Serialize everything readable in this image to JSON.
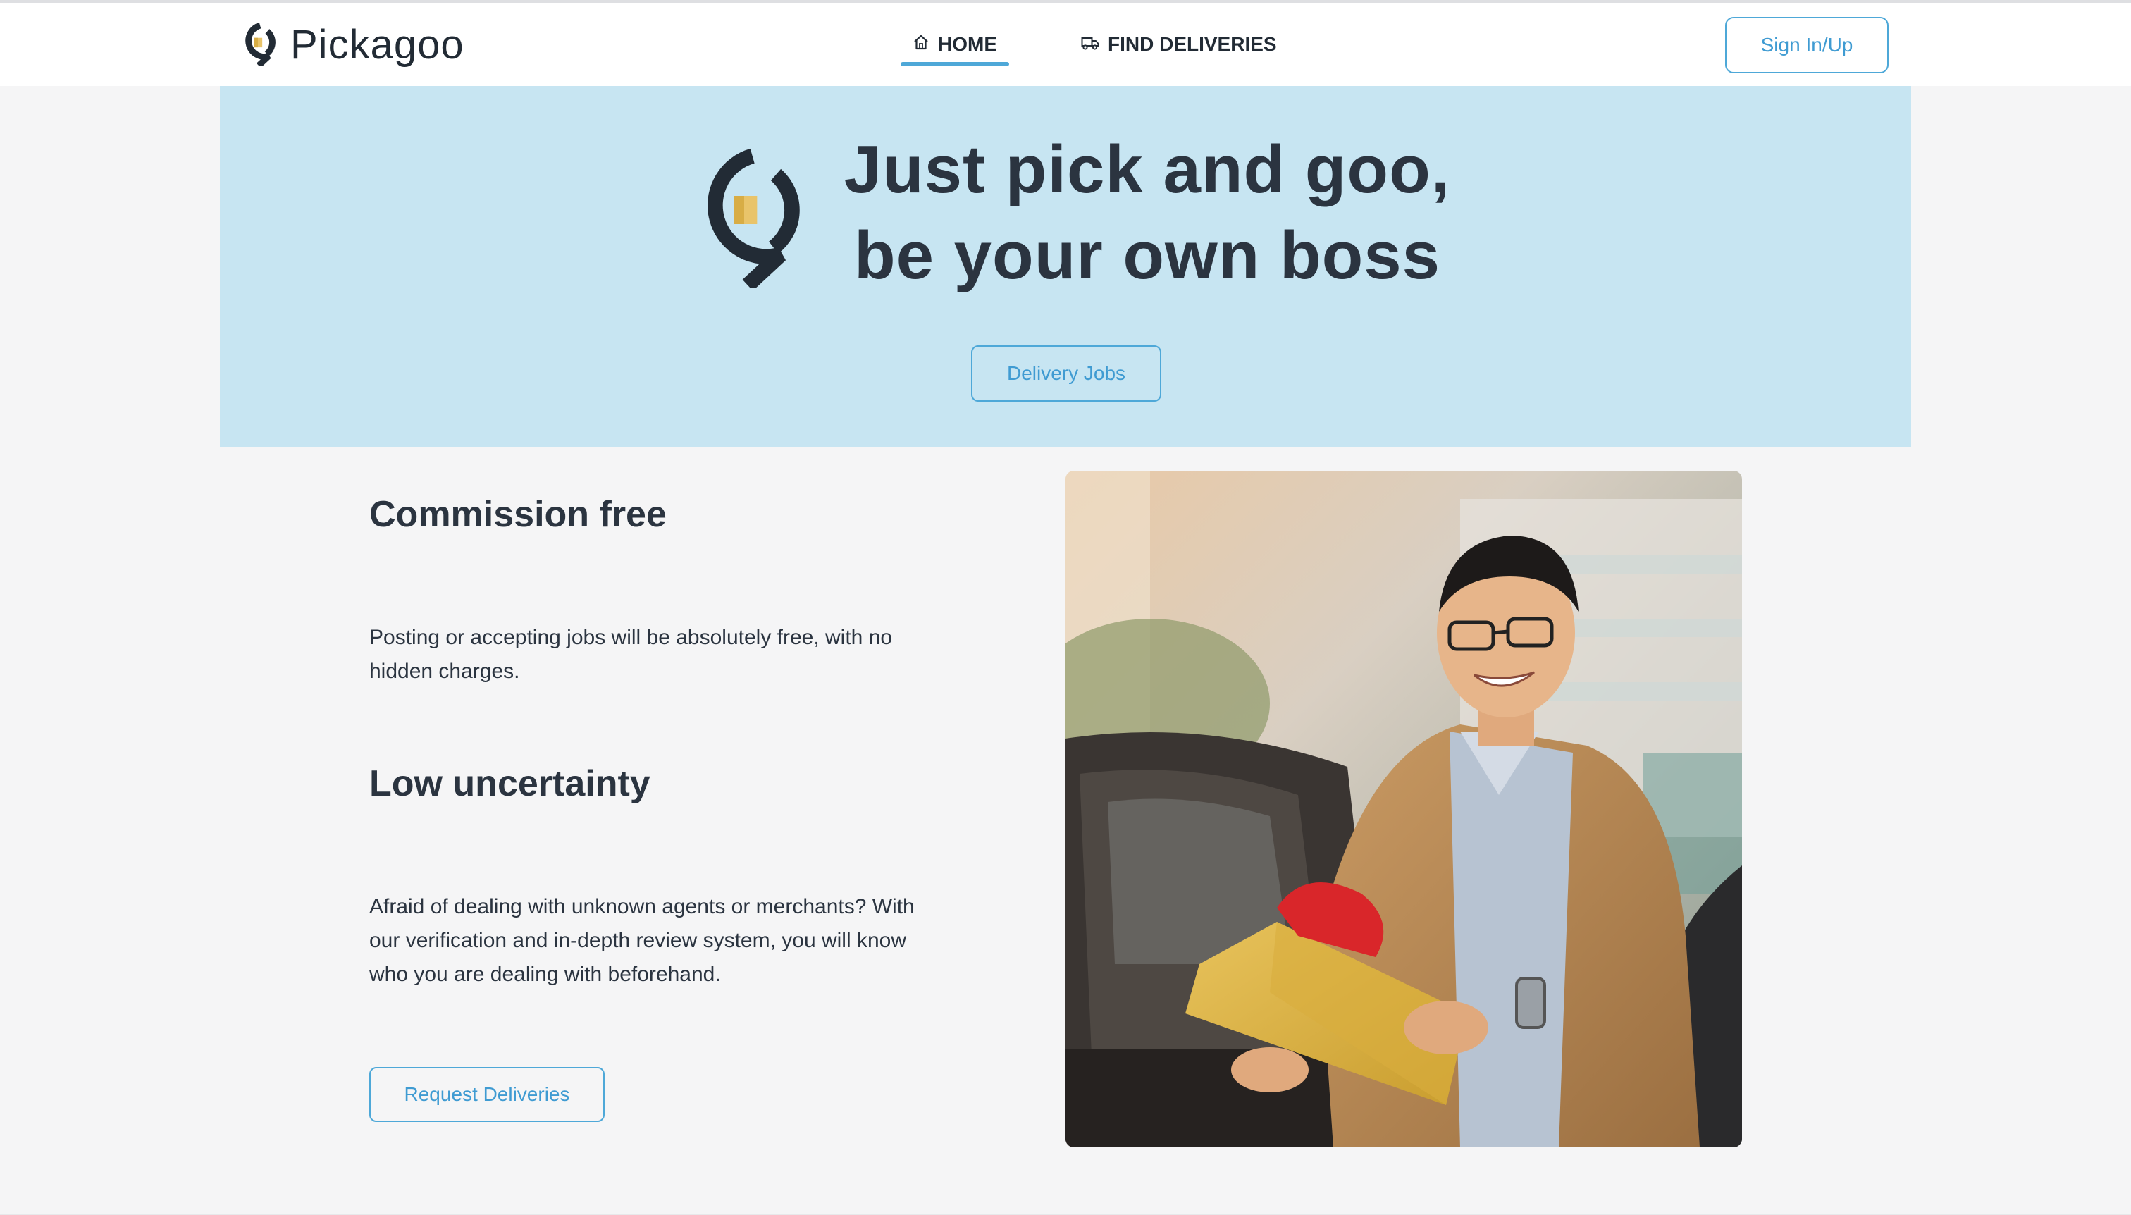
{
  "brand": {
    "name": "Pickagoo",
    "logo_icon": "pin-box-logo-icon"
  },
  "nav": {
    "links": [
      {
        "label": "HOME",
        "icon": "home-icon",
        "active": true
      },
      {
        "label": "FIND DELIVERIES",
        "icon": "truck-icon",
        "active": false
      }
    ],
    "signin_label": "Sign In/Up"
  },
  "hero": {
    "title_line1": "Just pick and goo,",
    "title_line2": "be your own boss",
    "button_label": "Delivery Jobs",
    "background": "#c7e5f2"
  },
  "features": [
    {
      "title": "Commission free",
      "text": "Posting or accepting jobs will be absolutely free, with no hidden charges."
    },
    {
      "title": "Low uncertainty",
      "text": "Afraid of dealing with unknown agents or merchants? With our verification and in-depth review system, you will know who you are dealing with beforehand."
    }
  ],
  "request_button_label": "Request Deliveries",
  "photo": {
    "subject": "smiling man in tan blazer holding a yellow parcel next to a car"
  },
  "colors": {
    "accent": "#4ea8d8",
    "text_dark": "#2b3440",
    "hero_bg": "#c7e5f2",
    "page_bg": "#f5f5f6",
    "logo_box": "#e9c46a"
  }
}
